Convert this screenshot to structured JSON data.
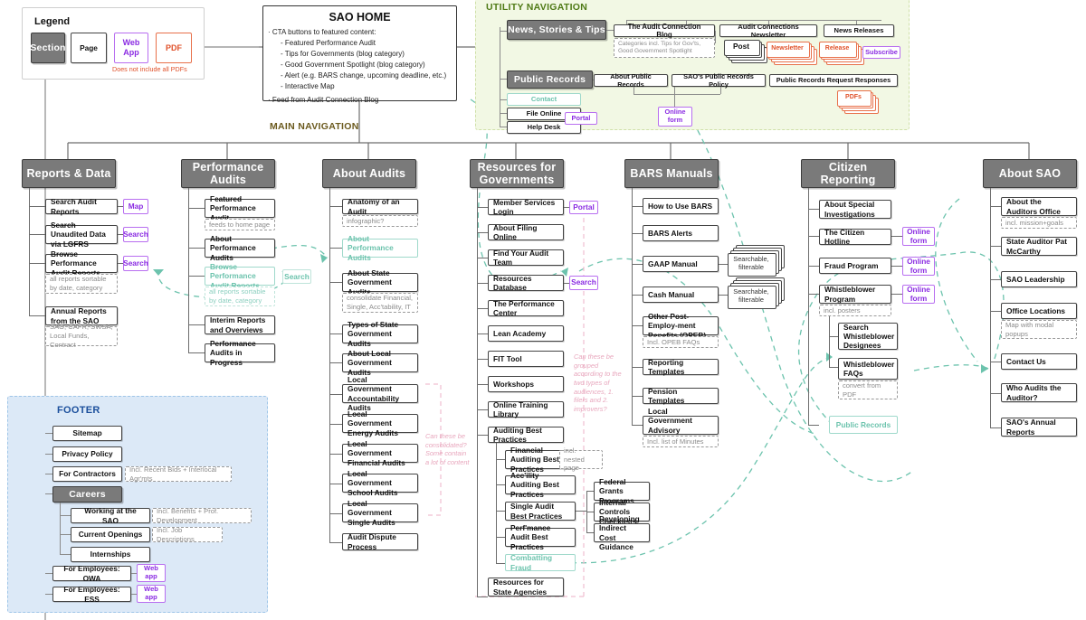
{
  "legend": {
    "title": "Legend",
    "items": [
      {
        "label": "Section",
        "type": "section"
      },
      {
        "label": "Page",
        "type": "page"
      },
      {
        "label": "Web App",
        "type": "webapp"
      },
      {
        "label": "PDF",
        "type": "pdf"
      }
    ],
    "footnote": "Does not include all PDFs"
  },
  "home": {
    "title": "SAO HOME",
    "bullets": [
      "CTA buttons to featured content:",
      "Featured Performance Audit",
      "Tips for Governments (blog category)",
      "Good Government Spotlight  (blog category)",
      "Alert (e.g. BARS change, upcoming deadline, etc.)",
      "Interactive Map",
      "Feed from Audit Connection Blog"
    ]
  },
  "utility": {
    "title": "UTILITY NAVIGATION",
    "news": {
      "section": "News, Stories & Tips",
      "children": [
        {
          "label": "The Audit Connection Blog",
          "note": "Categories incl. Tips for Gov'ts, Good Government Spotlight",
          "stack": "Post"
        },
        {
          "label": "Audit Connections Newsletter",
          "stack": "Newsletter"
        },
        {
          "label": "News Releases",
          "stack": "Release",
          "webapp": "Subscribe"
        }
      ]
    },
    "public_records": {
      "section": "Public Records",
      "children": [
        {
          "label": "About Public Records"
        },
        {
          "label": "SAO's Public Records Policy"
        },
        {
          "label": "Public Records Request Responses",
          "pdf_stack": "PDFs"
        }
      ],
      "online_form": "Online form"
    },
    "left_items": [
      {
        "label": "Contact",
        "ghost": true
      },
      {
        "label": "File Online",
        "webapp": "Portal"
      },
      {
        "label": "Help Desk"
      }
    ]
  },
  "main_nav": {
    "title": "MAIN NAVIGATION",
    "columns": [
      {
        "section": "Reports & Data",
        "items": [
          {
            "label": "Search Audit Reports",
            "badge": "Map",
            "badge_type": "webapp"
          },
          {
            "label": "Search Unaudited Data via LGFRS",
            "badge": "Search",
            "badge_type": "webapp"
          },
          {
            "label": "Browse Performance Audit Reports",
            "badge": "Search",
            "badge_type": "webapp",
            "note": "all reports sortable by date, category"
          },
          {
            "label": "Annual Reports from the SAO",
            "note": "SAO, CAFR, SWSA, Local Funds, Contract"
          }
        ]
      },
      {
        "section": "Performance Audits",
        "items": [
          {
            "label": "Featured Performance Audit",
            "note": "feeds to home page"
          },
          {
            "label": "About Performance Audits"
          },
          {
            "label": "Browse Performance Audit Reports",
            "ghost": true,
            "badge": "Search",
            "badge_type": "ghost",
            "note": "all reports sortable by date, category"
          },
          {
            "label": "Interim Reports and Overviews"
          },
          {
            "label": "Performance Audits in Progress"
          }
        ]
      },
      {
        "section": "About Audits",
        "items": [
          {
            "label": "Anatomy of an Audit",
            "note": "infographic?"
          },
          {
            "label": "About Performance Audits",
            "ghost": true
          },
          {
            "label": "About State Government Audits",
            "note": "consolidate Financial, Single, Acc'tability, IT"
          },
          {
            "label": "Types of State Government Audits"
          },
          {
            "label": "About Local Government Audits"
          },
          {
            "label": "Local Government Accountability Audits"
          },
          {
            "label": "Local Government Energy Audits"
          },
          {
            "label": "Local Government Financial Audits"
          },
          {
            "label": "Local Government School Audits"
          },
          {
            "label": "Local Government Single Audits"
          },
          {
            "label": "Audit Dispute Process"
          }
        ],
        "annotation": "Can these be consolidated? Some contain a lot of content"
      },
      {
        "section": "Resources for Governments",
        "items": [
          {
            "label": "Member Services Login",
            "badge": "Portal",
            "badge_type": "webapp"
          },
          {
            "label": "About Filing Online"
          },
          {
            "label": "Find Your Audit Team"
          },
          {
            "label": "Resources Database",
            "badge": "Search",
            "badge_type": "webapp"
          },
          {
            "label": "The Performance Center"
          },
          {
            "label": "Lean Academy"
          },
          {
            "label": "FIT Tool"
          },
          {
            "label": "Workshops"
          },
          {
            "label": "Online Training Library"
          },
          {
            "label": "Auditing Best Practices"
          },
          {
            "label": "Resources for State Agencies"
          }
        ],
        "sub_items": [
          {
            "label": "Financial Auditing Best Practices",
            "note": "incl. nested page"
          },
          {
            "label": "Acc'ility Auditing Best Practices"
          },
          {
            "label": "Single Audit Best Practices"
          },
          {
            "label": "Perf'mance Audit Best Practices"
          },
          {
            "label": "Combatting Fraud",
            "ghost": true
          }
        ],
        "sub_sub_items": [
          {
            "label": "Federal Grants Programs"
          },
          {
            "label": "Internal Controls Checklists"
          },
          {
            "label": "Developing Indirect Cost Guidance"
          }
        ],
        "annotation": "Can these be grouped according to the two types of audiences, 1. filers and 2. improvers?"
      },
      {
        "section": "BARS Manuals",
        "items": [
          {
            "label": "How to Use BARS"
          },
          {
            "label": "BARS Alerts"
          },
          {
            "label": "GAAP Manual",
            "stack": "Searchable, filterable"
          },
          {
            "label": "Cash Manual",
            "stack": "Searchable, filterable"
          },
          {
            "label": "Other Post-Employ-ment Benefits (OPEB)",
            "note": "Incl. OPEB FAQs"
          },
          {
            "label": "Reporting Templates"
          },
          {
            "label": "Pension Templates"
          },
          {
            "label": "Local Government Advisory Committee",
            "note": "Incl. list of Minutes"
          }
        ]
      },
      {
        "section": "Citizen Reporting",
        "items": [
          {
            "label": "About Special Investigations"
          },
          {
            "label": "The Citizen Hotline",
            "badge": "Online form",
            "badge_type": "webapp"
          },
          {
            "label": "Fraud Program",
            "badge": "Online form",
            "badge_type": "webapp"
          },
          {
            "label": "Whistleblower Program",
            "badge": "Online form",
            "badge_type": "webapp",
            "note": "incl. posters"
          },
          {
            "label": "Public Records",
            "ghost": true
          }
        ],
        "sub_items": [
          {
            "label": "Search Whistleblower Designees"
          },
          {
            "label": "Whistleblower FAQs",
            "note": "convert from PDF"
          }
        ]
      },
      {
        "section": "About SAO",
        "items": [
          {
            "label": "About the Auditors Office",
            "note": "incl. mission+goals"
          },
          {
            "label": "State Auditor Pat McCarthy"
          },
          {
            "label": "SAO Leadership"
          },
          {
            "label": "Office Locations",
            "note": "Map with modal popups"
          },
          {
            "label": "Contact Us"
          },
          {
            "label": "Who Audits the Auditor?"
          },
          {
            "label": "SAO's Annual Reports"
          }
        ]
      }
    ]
  },
  "footer": {
    "title": "FOOTER",
    "items": [
      {
        "label": "Sitemap"
      },
      {
        "label": "Privacy Policy"
      },
      {
        "label": "For Contractors",
        "note": "Incl. Recent Bids + Interlocal Agr'mts"
      },
      {
        "label": "Careers",
        "type": "section"
      },
      {
        "label": "For Employees: OWA",
        "badge": "Web app",
        "badge_type": "webapp"
      },
      {
        "label": "For Employees: ESS",
        "badge": "Web app",
        "badge_type": "webapp"
      }
    ],
    "careers_children": [
      {
        "label": "Working at the SAO",
        "note": "Incl. Benefits + Prof. Development"
      },
      {
        "label": "Current Openings",
        "note": "Incl. Job Descriptions"
      },
      {
        "label": "Internships"
      }
    ]
  },
  "colors": {
    "section_fill": "#7a7a7a",
    "webapp": "#8a2be2",
    "pdf": "#e0512a",
    "ghost": "#6cc3ad",
    "utility_region": "#f2f8e4",
    "footer_region": "#dce9f7",
    "annotation": "#e8a7bd"
  }
}
